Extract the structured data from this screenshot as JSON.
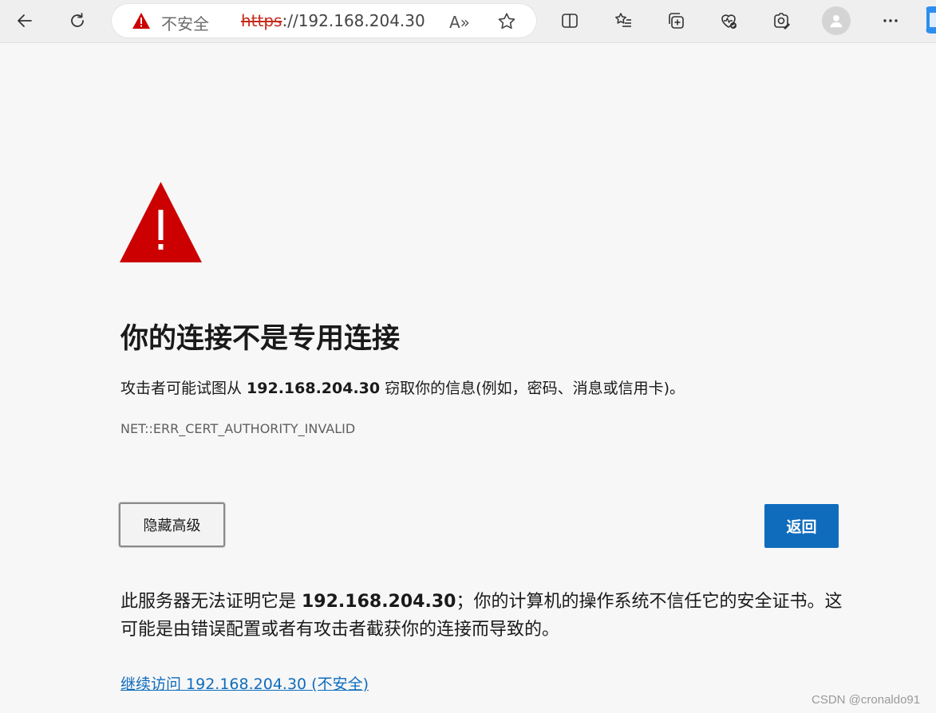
{
  "browser": {
    "address_bar": {
      "security_label": "不安全",
      "url_scheme": "https",
      "url_rest": "://192.168.204.30",
      "read_aloud_label": "A»"
    },
    "icons": [
      "back-icon",
      "refresh-icon",
      "warning-icon",
      "read-aloud-icon",
      "favorite-star-icon",
      "split-screen-icon",
      "favorites-list-icon",
      "collections-icon",
      "browser-essentials-icon",
      "screenshot-icon",
      "profile-icon",
      "more-icon",
      "copilot-icon"
    ]
  },
  "page": {
    "heading": "你的连接不是专用连接",
    "attack_text_before": "攻击者可能试图从 ",
    "host": "192.168.204.30",
    "attack_text_after": " 窃取你的信息(例如，密码、消息或信用卡)。",
    "error_code": "NET::ERR_CERT_AUTHORITY_INVALID",
    "hide_advanced_button": "隐藏高级",
    "back_button": "返回",
    "detail_before": "此服务器无法证明它是 ",
    "detail_after": "；你的计算机的操作系统不信任它的安全证书。这可能是由错误配置或者有攻击者截获你的连接而导致的。",
    "continue_link": "继续访问 192.168.204.30 (不安全)"
  },
  "watermark": "CSDN @cronaldo91",
  "colors": {
    "warning_red": "#cc0000",
    "accent_blue": "#0f6cbd",
    "page_bg": "#f7f7f7"
  }
}
